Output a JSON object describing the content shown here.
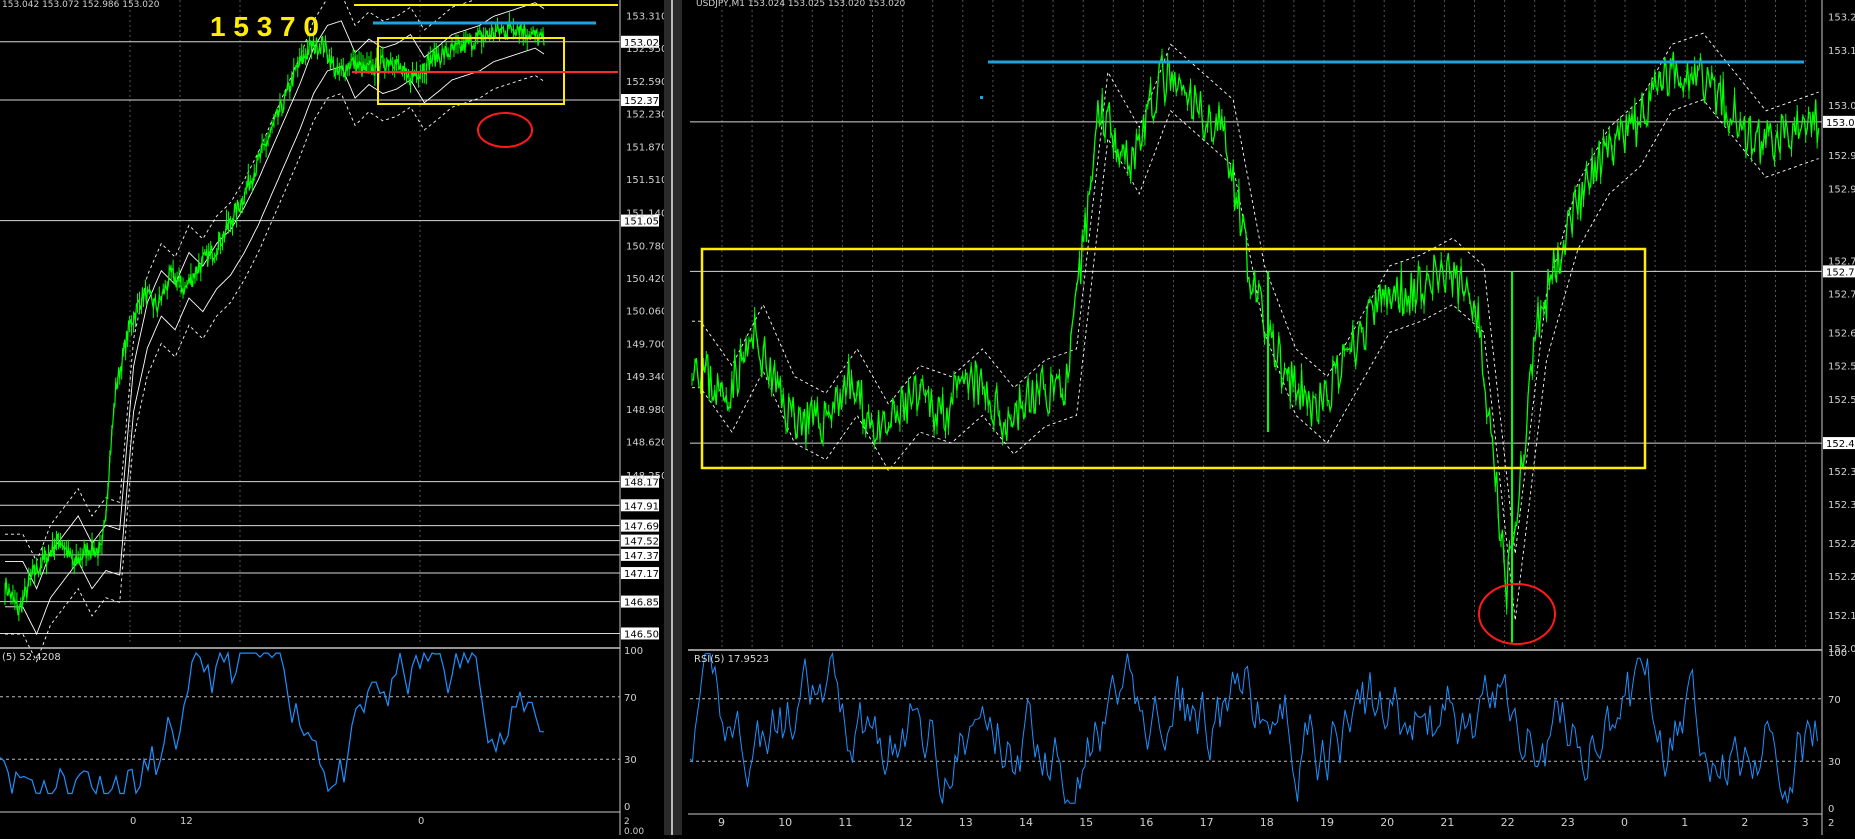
{
  "colors": {
    "background": "#000000",
    "price": "#00ff00",
    "band_solid": "#ffffff",
    "band_dotted": "#ffffff",
    "rsi": "#1e90ff",
    "level_blue": "#1fa2e0",
    "level_red": "#ff2a2a",
    "box_yellow": "#ffee00",
    "circle_red": "#ff1a1a",
    "separator": "#c8c8c8"
  },
  "left_panel": {
    "header": "153.042 153.072 152.986 153.020",
    "big_label": "1 5 3 7 0",
    "price_axis_ticks": [
      "153.310",
      "152.950",
      "152.590",
      "152.230",
      "151.870",
      "151.510",
      "151.140",
      "150.780",
      "150.420",
      "150.060",
      "149.700",
      "149.340",
      "148.980",
      "148.620",
      "148.250"
    ],
    "level_labels": [
      "153.020",
      "152.379",
      "151.052",
      "148.178",
      "147.918",
      "147.694",
      "147.529",
      "147.372",
      "147.172",
      "146.858",
      "146.507"
    ],
    "rsi_label": "(5) 52.4208",
    "rsi_axis": [
      "100",
      "70",
      "30",
      "0"
    ],
    "time_axis": [
      "0",
      "12",
      "0"
    ],
    "time_axis_right": [
      "2",
      "0.00"
    ]
  },
  "right_panel": {
    "header": "USDJPY,M1  153.024 153.025 153.020 153.020",
    "price_axis_ticks": [
      "153.21",
      "153.15",
      "153.05",
      "152.96",
      "152.90",
      "152.77",
      "152.71",
      "152.64",
      "152.58",
      "152.52",
      "152.39",
      "152.33",
      "152.26",
      "152.20",
      "152.13",
      "152.07"
    ],
    "level_labels": [
      "153.02",
      "152.75",
      "152.44"
    ],
    "rsi_label": "RSI(5) 17.9523",
    "rsi_axis": [
      "100",
      "70",
      "30",
      "0"
    ],
    "time_axis": [
      "9",
      "10",
      "11",
      "12",
      "13",
      "14",
      "15",
      "16",
      "17",
      "18",
      "19",
      "20",
      "21",
      "22",
      "23",
      "0",
      "1",
      "2",
      "3"
    ],
    "time_axis_right": [
      "2"
    ]
  },
  "chart_data": [
    {
      "type": "line",
      "title": "",
      "xlabel": "",
      "ylabel": "",
      "ylim": [
        146.38,
        153.48
      ],
      "x": [
        0,
        1,
        2,
        3,
        4,
        5,
        6,
        7,
        8,
        9,
        10,
        11,
        12,
        13,
        14,
        15,
        16,
        17,
        18,
        19,
        20,
        21,
        22,
        23,
        24,
        25,
        26,
        27,
        28,
        29,
        30,
        31,
        32,
        33,
        34,
        35,
        36,
        37,
        38,
        39
      ],
      "series": [
        {
          "values": [
            147.05,
            146.75,
            147.15,
            147.35,
            147.55,
            147.25,
            147.45,
            147.4,
            149.2,
            149.9,
            150.25,
            150.1,
            150.45,
            150.3,
            150.55,
            150.7,
            150.95,
            151.25,
            151.6,
            151.95,
            152.3,
            152.7,
            152.95,
            153.0,
            152.65,
            152.8,
            152.7,
            152.75,
            152.85,
            152.6,
            152.72,
            152.85,
            152.9,
            152.95,
            153.05,
            153.1,
            153.15,
            153.2,
            153.1,
            153.02
          ]
        }
      ],
      "horizontal_levels": [
        153.31,
        153.02,
        152.379,
        151.052,
        148.178,
        147.918,
        147.694,
        147.529,
        147.372,
        147.172,
        146.858,
        146.507
      ]
    },
    {
      "type": "line",
      "title": "",
      "xlabel": "",
      "ylabel": "",
      "ylim": [
        152.07,
        153.24
      ],
      "x": [
        "9",
        "",
        "10",
        "",
        "11",
        "",
        "12",
        "",
        "13",
        "",
        "14",
        "",
        "15",
        "",
        "16",
        "",
        "17",
        "",
        "18",
        "",
        "19",
        "",
        "20",
        "",
        "21",
        "",
        "22",
        "",
        "23",
        "",
        "0",
        "",
        "1",
        "",
        "2",
        "",
        "3"
      ],
      "series": [
        {
          "values": [
            152.6,
            152.52,
            152.63,
            152.5,
            152.47,
            152.55,
            152.45,
            152.52,
            152.5,
            152.55,
            152.48,
            152.53,
            152.55,
            153.05,
            152.95,
            153.1,
            153.05,
            153.0,
            152.7,
            152.55,
            152.5,
            152.6,
            152.7,
            152.72,
            152.75,
            152.7,
            152.18,
            152.65,
            152.85,
            152.95,
            153.0,
            153.1,
            153.12,
            153.05,
            152.98,
            153.0,
            153.02
          ]
        }
      ],
      "horizontal_levels": [
        153.15,
        153.02,
        152.75,
        152.44
      ]
    }
  ]
}
